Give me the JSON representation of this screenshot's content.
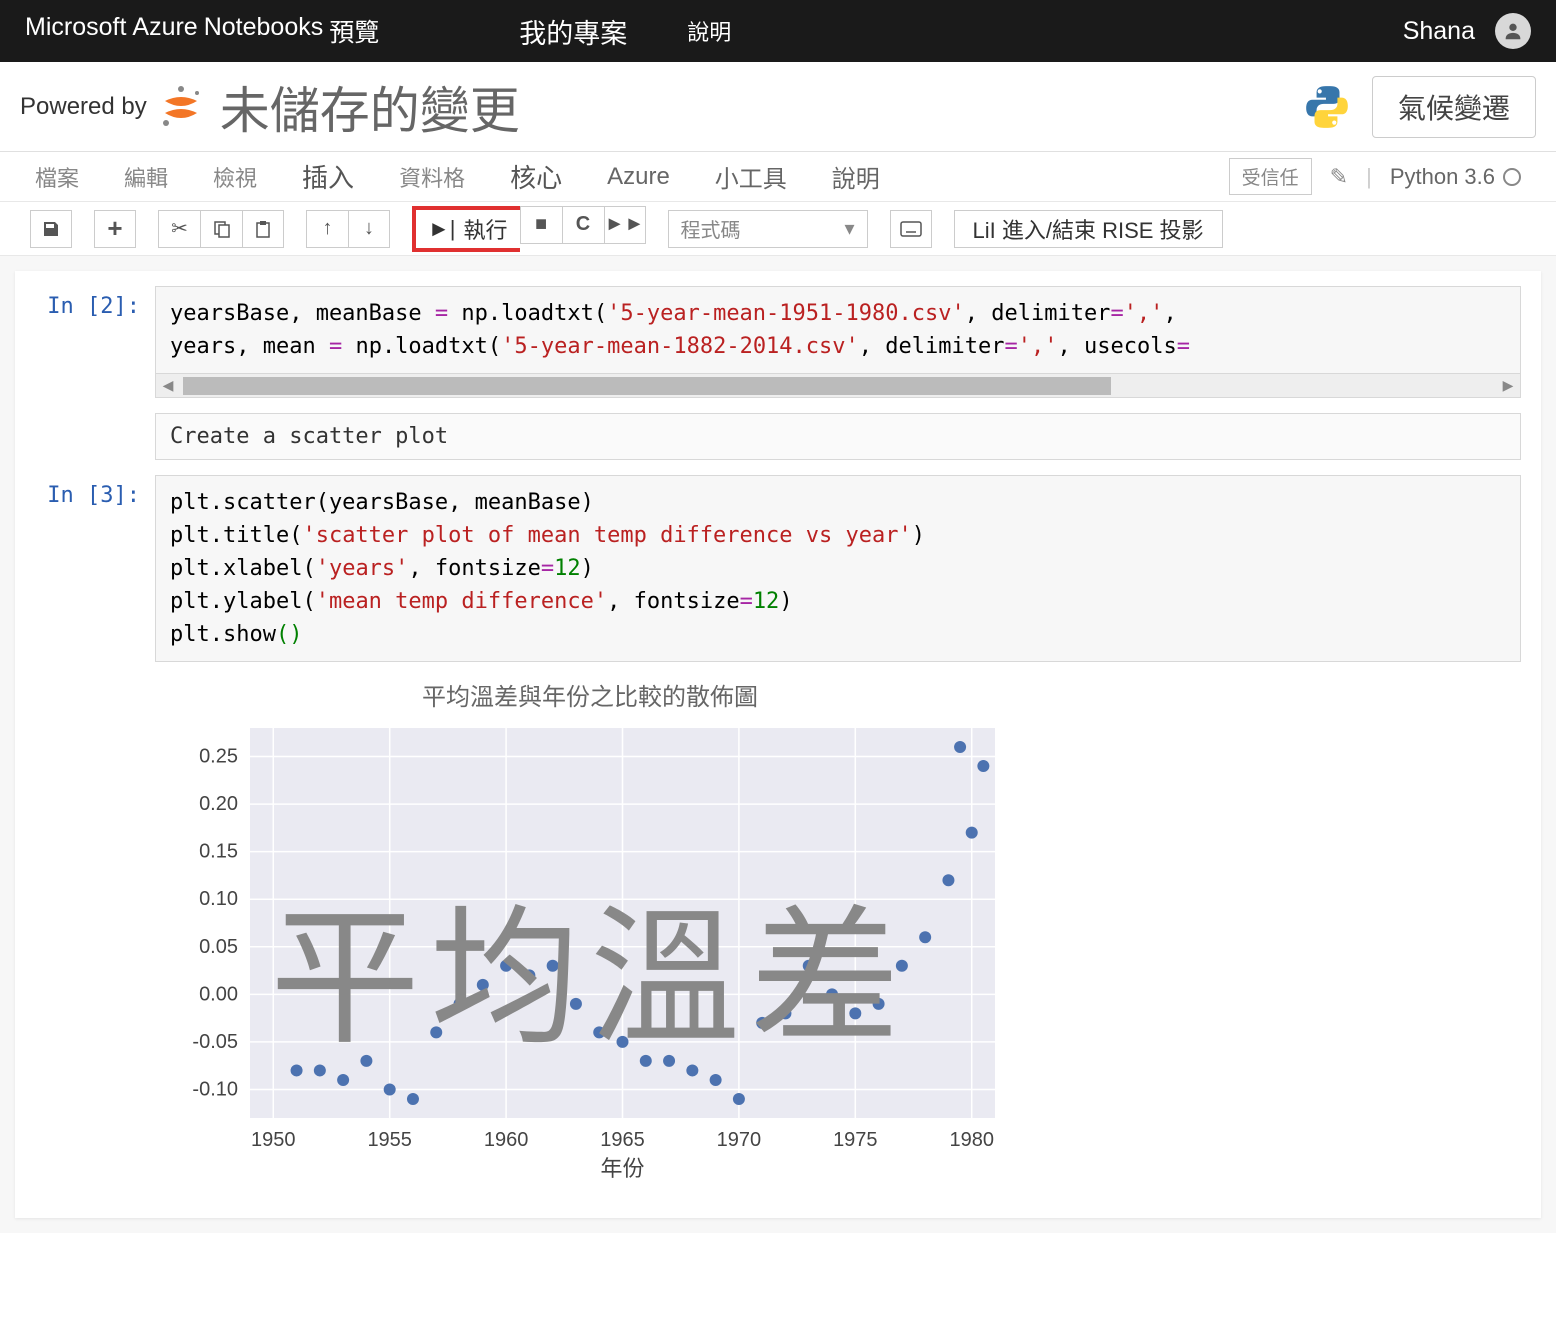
{
  "topbar": {
    "brand_ms": "Microsoft",
    "brand_az": "Azure",
    "brand_nb": "Notebooks",
    "preview": "預覽",
    "my_project": "我的專案",
    "help": "說明",
    "user": "Shana"
  },
  "subbar": {
    "powered": "Powered by",
    "status": "未儲存的變更",
    "project_btn": "氣候變遷"
  },
  "menu": {
    "file": "檔案",
    "edit": "編輯",
    "view": "檢視",
    "insert": "插入",
    "cellfmt": "資料格",
    "kernel": "核心",
    "azure": "Azure",
    "widgets": "小工具",
    "help": "說明",
    "trusted": "受信任",
    "kernel_name": "Python 3.6"
  },
  "toolbar": {
    "run": "執行",
    "celltype": "程式碼",
    "rise": "LiI 進入/結束 RISE 投影"
  },
  "cells": {
    "in2": "In [2]:",
    "in3": "In [3]:",
    "markdown": "Create a scatter plot"
  },
  "code2": {
    "l1a": "yearsBase, meanBase ",
    "l1b": " np.loadtxt(",
    "l1c": "'5-year-mean-1951-1980.csv'",
    "l1d": ", delimiter",
    "l1e": "','",
    "l1f": ",",
    "l2a": "years, mean ",
    "l2b": " np.loadtxt(",
    "l2c": "'5-year-mean-1882-2014.csv'",
    "l2d": ", delimiter",
    "l2e": "','",
    "l2f": ", usecols",
    "eq": "=",
    "eq2": "="
  },
  "code3": {
    "l1": "plt.scatter(yearsBase, meanBase)",
    "l2a": "plt.title(",
    "l2b": "'scatter plot of mean temp difference vs year'",
    "l2c": ")",
    "l3a": "plt.xlabel(",
    "l3b": "'years'",
    "l3c": ", fontsize",
    "l3d": "12",
    "l3e": ")",
    "l4a": "plt.ylabel(",
    "l4b": "'mean temp difference'",
    "l4c": ", fontsize",
    "l4d": "12",
    "l4e": ")",
    "l5a": "plt.show",
    "l5b": "()",
    "eq": "="
  },
  "chart": {
    "title": "平均溫差與年份之比較的散佈圖",
    "xlabel": "年份",
    "watermark": "平均溫差"
  },
  "chart_data": {
    "type": "scatter",
    "title": "平均溫差與年份之比較的散佈圖",
    "xlabel": "年份",
    "ylabel": "平均溫差",
    "xlim": [
      1949,
      1981
    ],
    "ylim": [
      -0.13,
      0.28
    ],
    "xticks": [
      1950,
      1955,
      1960,
      1965,
      1970,
      1975,
      1980
    ],
    "yticks": [
      -0.1,
      -0.05,
      0.0,
      0.05,
      0.1,
      0.15,
      0.2,
      0.25
    ],
    "x": [
      1951,
      1952,
      1953,
      1954,
      1955,
      1956,
      1957,
      1958,
      1959,
      1960,
      1961,
      1962,
      1963,
      1964,
      1965,
      1966,
      1967,
      1968,
      1969,
      1970,
      1971,
      1972,
      1973,
      1974,
      1975,
      1976,
      1977,
      1978,
      1979,
      1980
    ],
    "y": [
      -0.08,
      -0.08,
      -0.09,
      -0.07,
      -0.1,
      -0.11,
      -0.04,
      -0.01,
      0.01,
      0.03,
      0.02,
      0.03,
      -0.01,
      -0.04,
      -0.05,
      -0.07,
      -0.07,
      -0.08,
      -0.09,
      -0.11,
      -0.03,
      -0.02,
      0.03,
      0.0,
      -0.02,
      -0.01,
      0.03,
      0.06,
      0.12,
      0.17
    ]
  },
  "chart_extra_points": {
    "x": [
      1979.5,
      1980.5
    ],
    "y": [
      0.26,
      0.24
    ]
  }
}
